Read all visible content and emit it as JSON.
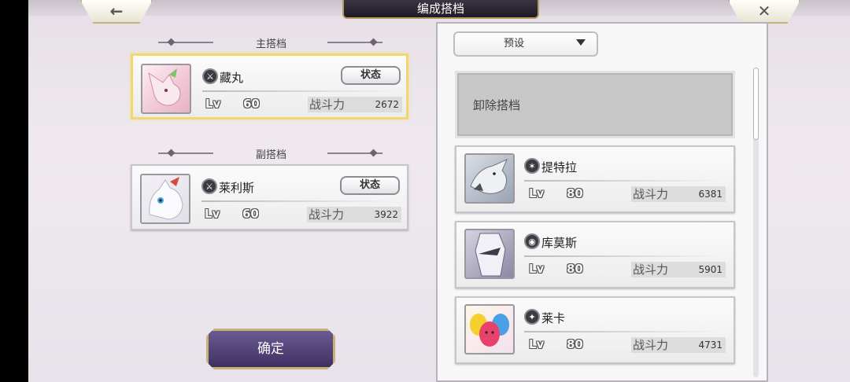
{
  "header": {
    "title": "编成搭档",
    "back_icon": "arrow-left-icon",
    "close_icon": "close-icon"
  },
  "main_partner": {
    "section_label": "主搭档",
    "name": "藏丸",
    "type_icon": "sword-icon",
    "status_label": "状态",
    "lv_label": "Lv",
    "level": "60",
    "power_label": "战斗力",
    "power": "2672"
  },
  "sub_partner": {
    "section_label": "副搭档",
    "name": "莱利斯",
    "type_icon": "sword-icon",
    "status_label": "状态",
    "lv_label": "Lv",
    "level": "60",
    "power_label": "战斗力",
    "power": "3922"
  },
  "confirm_label": "确定",
  "right_panel": {
    "preset_label": "预设",
    "unequip_label": "卸除搭档",
    "list": [
      {
        "name": "提特拉",
        "type_icon": "claw-icon",
        "lv_label": "Lv",
        "level": "80",
        "power_label": "战斗力",
        "power": "6381"
      },
      {
        "name": "库莫斯",
        "type_icon": "eye-icon",
        "lv_label": "Lv",
        "level": "80",
        "power_label": "战斗力",
        "power": "5901"
      },
      {
        "name": "莱卡",
        "type_icon": "star-icon",
        "lv_label": "Lv",
        "level": "80",
        "power_label": "战斗力",
        "power": "4731"
      }
    ]
  }
}
